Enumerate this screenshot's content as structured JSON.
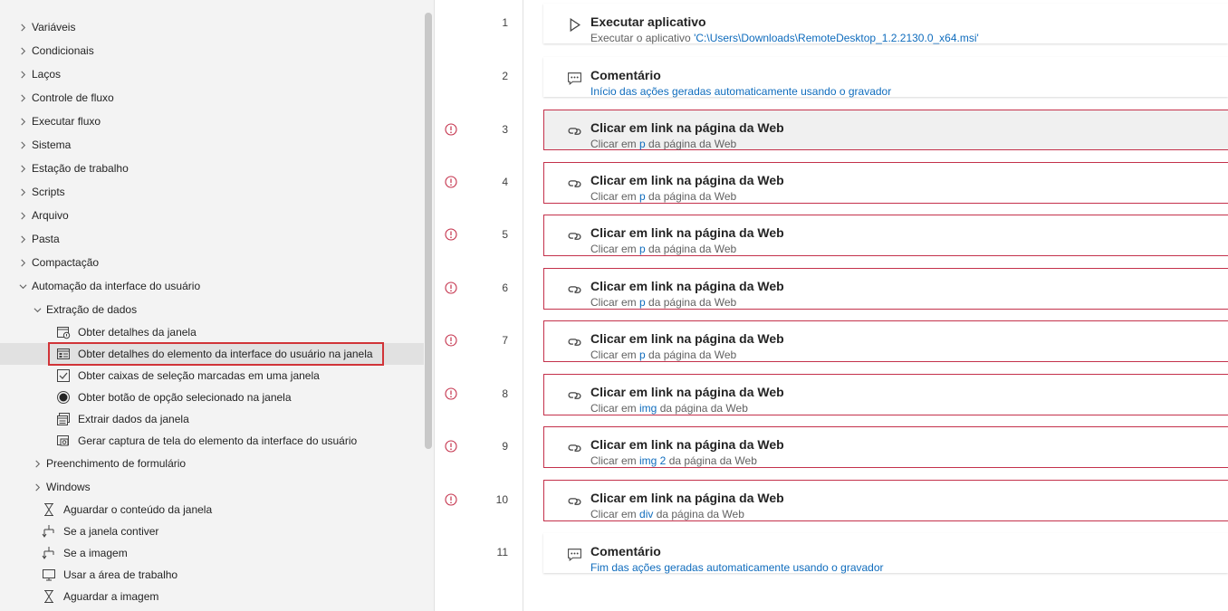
{
  "sidebar": {
    "categories": [
      {
        "label": "Variáveis"
      },
      {
        "label": "Condicionais"
      },
      {
        "label": "Laços"
      },
      {
        "label": "Controle de fluxo"
      },
      {
        "label": "Executar fluxo"
      },
      {
        "label": "Sistema"
      },
      {
        "label": "Estação de trabalho"
      },
      {
        "label": "Scripts"
      },
      {
        "label": "Arquivo"
      },
      {
        "label": "Pasta"
      },
      {
        "label": "Compactação"
      }
    ],
    "ui_automation": {
      "label": "Automação da interface do usuário",
      "data_extraction": {
        "label": "Extração de dados",
        "items": [
          {
            "label": "Obter detalhes da janela",
            "icon": "window-details-icon"
          },
          {
            "label": "Obter detalhes do elemento da interface do usuário na janela",
            "icon": "element-details-icon"
          },
          {
            "label": "Obter caixas de seleção marcadas em uma janela",
            "icon": "checkbox-icon"
          },
          {
            "label": "Obter botão de opção selecionado na janela",
            "icon": "radio-button-icon"
          },
          {
            "label": "Extrair dados da janela",
            "icon": "extract-data-icon"
          },
          {
            "label": "Gerar captura de tela do elemento da interface do usuário",
            "icon": "screenshot-icon"
          }
        ]
      },
      "form_filling": {
        "label": "Preenchimento de formulário"
      },
      "windows": {
        "label": "Windows"
      },
      "items": [
        {
          "label": "Aguardar o conteúdo da janela",
          "icon": "hourglass-icon"
        },
        {
          "label": "Se a janela contiver",
          "icon": "branch-icon"
        },
        {
          "label": "Se a imagem",
          "icon": "branch-icon"
        },
        {
          "label": "Usar a área de trabalho",
          "icon": "desktop-icon"
        },
        {
          "label": "Aguardar a imagem",
          "icon": "hourglass-icon"
        }
      ]
    }
  },
  "flow": {
    "steps": [
      {
        "num": "1",
        "title": "Executar aplicativo",
        "desc_pre": "Executar o aplicativo ",
        "desc_link": "'C:\\Users\\Downloads\\RemoteDesktop_1.2.2130.0_x64.msi'",
        "desc_post": "",
        "icon": "play-icon",
        "error": false
      },
      {
        "num": "2",
        "title": "Comentário",
        "desc_pre": "",
        "desc_link": "Início das ações geradas automaticamente usando o gravador",
        "desc_post": "",
        "icon": "comment-icon",
        "error": false
      },
      {
        "num": "3",
        "title": "Clicar em link na página da Web",
        "desc_pre": "Clicar em ",
        "desc_link": "p",
        "desc_post": " da página da Web",
        "icon": "link-icon",
        "error": true
      },
      {
        "num": "4",
        "title": "Clicar em link na página da Web",
        "desc_pre": "Clicar em ",
        "desc_link": "p",
        "desc_post": " da página da Web",
        "icon": "link-icon",
        "error": true
      },
      {
        "num": "5",
        "title": "Clicar em link na página da Web",
        "desc_pre": "Clicar em ",
        "desc_link": "p",
        "desc_post": " da página da Web",
        "icon": "link-icon",
        "error": true
      },
      {
        "num": "6",
        "title": "Clicar em link na página da Web",
        "desc_pre": "Clicar em ",
        "desc_link": "p",
        "desc_post": " da página da Web",
        "icon": "link-icon",
        "error": true
      },
      {
        "num": "7",
        "title": "Clicar em link na página da Web",
        "desc_pre": "Clicar em ",
        "desc_link": "p",
        "desc_post": " da página da Web",
        "icon": "link-icon",
        "error": true
      },
      {
        "num": "8",
        "title": "Clicar em link na página da Web",
        "desc_pre": "Clicar em ",
        "desc_link": "img",
        "desc_post": " da página da Web",
        "icon": "link-icon",
        "error": true
      },
      {
        "num": "9",
        "title": "Clicar em link na página da Web",
        "desc_pre": "Clicar em ",
        "desc_link": "img 2",
        "desc_post": " da página da Web",
        "icon": "link-icon",
        "error": true
      },
      {
        "num": "10",
        "title": "Clicar em link na página da Web",
        "desc_pre": "Clicar em ",
        "desc_link": "div",
        "desc_post": " da página da Web",
        "icon": "link-icon",
        "error": true
      },
      {
        "num": "11",
        "title": "Comentário",
        "desc_pre": "",
        "desc_link": "Fim das ações geradas automaticamente usando o gravador",
        "desc_post": "",
        "icon": "comment-icon",
        "error": false
      }
    ]
  },
  "colors": {
    "error": "#c4314b",
    "link": "#0f6cbd",
    "highlight": "#d13438"
  }
}
